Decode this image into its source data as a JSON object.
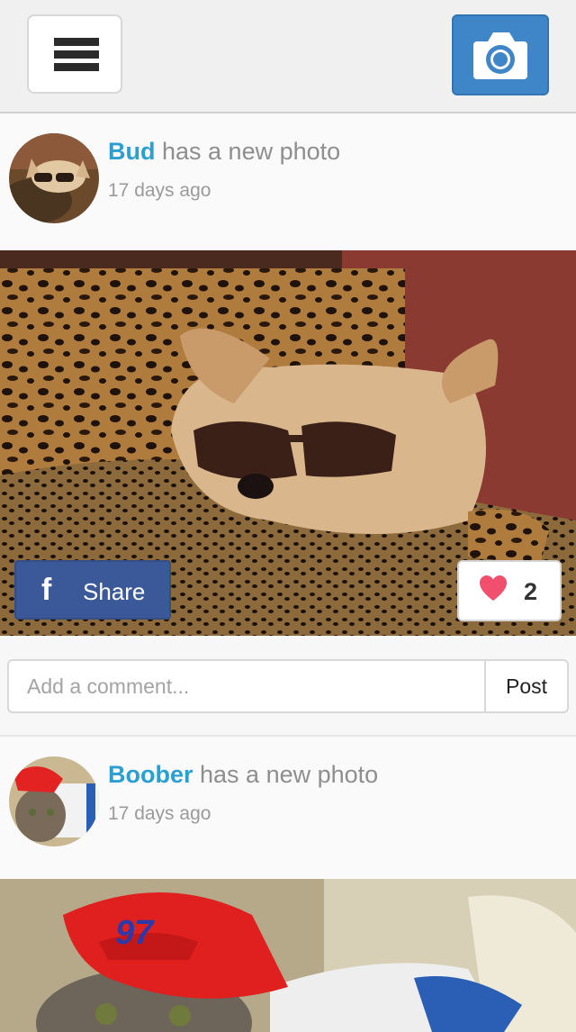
{
  "topbar": {
    "menu_icon": "hamburger-menu-icon",
    "camera_icon": "camera-icon",
    "accent_color": "#3f86c8"
  },
  "posts": [
    {
      "username": "Bud",
      "action_text": "has a new photo",
      "time_ago": "17 days ago",
      "share_label": "Share",
      "like_count": "2",
      "comment_placeholder": "Add a comment...",
      "post_label": "Post"
    },
    {
      "username": "Boober",
      "action_text": "has a new photo",
      "time_ago": "17 days ago"
    }
  ],
  "colors": {
    "username": "#2a9fd1",
    "facebook": "#3b5998",
    "heart": "#f0506e"
  }
}
